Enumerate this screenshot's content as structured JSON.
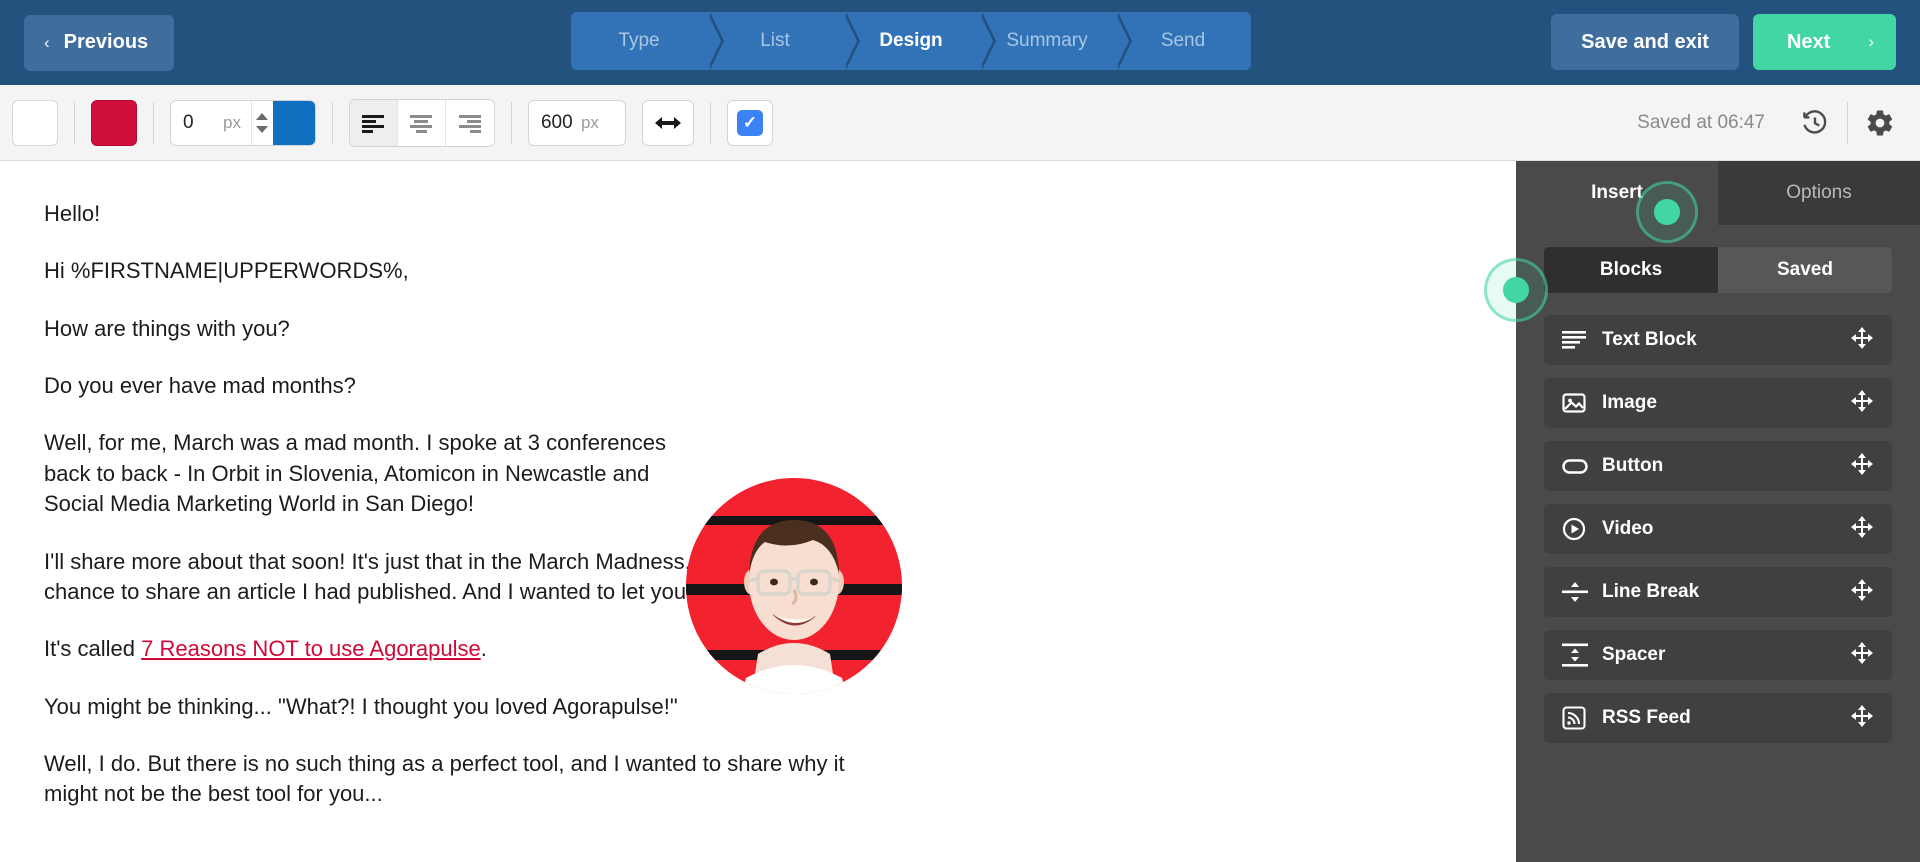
{
  "header": {
    "previous_label": "Previous",
    "previous_chevron": "‹",
    "save_exit_label": "Save and exit",
    "next_label": "Next",
    "next_chevron": "›",
    "steps": [
      {
        "label": "Type",
        "active": false
      },
      {
        "label": "List",
        "active": false
      },
      {
        "label": "Design",
        "active": true
      },
      {
        "label": "Summary",
        "active": false
      },
      {
        "label": "Send",
        "active": false
      }
    ],
    "colors": {
      "bar": "#23527f",
      "step": "#3273b8",
      "next": "#42d6a4",
      "secondary": "#3f6d9e"
    }
  },
  "toolbar": {
    "background_swatch_color": "#ffffff",
    "text_color_swatch_color": "#d0103a",
    "border_width_value": "0",
    "border_width_unit": "px",
    "border_color_swatch_color": "#0f6fc0",
    "align_left_icon": "align-left-icon",
    "align_center_icon": "align-center-icon",
    "align_right_icon": "align-right-icon",
    "active_alignment": "left",
    "width_value": "600",
    "width_unit": "px",
    "full_width_icon": "arrows-horizontal-icon",
    "responsive_checkbox_checked": true,
    "checkmark": "✓",
    "saved_status": "Saved at 06:47",
    "history_icon": "history-revert-icon",
    "settings_icon": "gear-icon"
  },
  "email": {
    "paragraphs": [
      {
        "text": "Hello!"
      },
      {
        "text": "Hi %FIRSTNAME|UPPERWORDS%,"
      },
      {
        "text": "How are things with you?"
      },
      {
        "text": "Do you ever have mad months?"
      },
      {
        "text": "Well, for me, March was a mad month. I spoke at 3 conferences back to back - In Orbit in Slovenia, Atomicon in Newcastle and Social Media Marketing World in San Diego!"
      },
      {
        "text": "I'll share more about that soon! It's just that in the March Madness, I didn't get the chance to share an article I had published.  And I wanted to let you know about it."
      }
    ],
    "link_line": {
      "before": "It's called ",
      "link_text": "7 Reasons NOT to use Agorapulse",
      "after": "."
    },
    "paragraphs_after": [
      {
        "text": "You might be thinking... \"What?! I thought you loved Agorapulse!\""
      },
      {
        "text": "Well, I do. But there is no such thing as a perfect tool, and I wanted to share why it might not be the best tool for you..."
      }
    ],
    "avatar_alt": "profile-photo-man-with-glasses",
    "link_color": "#cf0a38"
  },
  "panel": {
    "tabs": [
      {
        "label": "Insert",
        "active": true
      },
      {
        "label": "Options",
        "active": false
      }
    ],
    "segments": [
      {
        "label": "Blocks",
        "active": true
      },
      {
        "label": "Saved",
        "active": false
      }
    ],
    "blocks": [
      {
        "label": "Text Block",
        "icon": "text-lines-icon"
      },
      {
        "label": "Image",
        "icon": "image-icon"
      },
      {
        "label": "Button",
        "icon": "button-pill-icon"
      },
      {
        "label": "Video",
        "icon": "play-circle-icon"
      },
      {
        "label": "Line Break",
        "icon": "line-break-icon"
      },
      {
        "label": "Spacer",
        "icon": "spacer-icon"
      },
      {
        "label": "RSS Feed",
        "icon": "rss-feed-icon"
      }
    ],
    "drag_handle_icon": "move-arrows-icon"
  }
}
